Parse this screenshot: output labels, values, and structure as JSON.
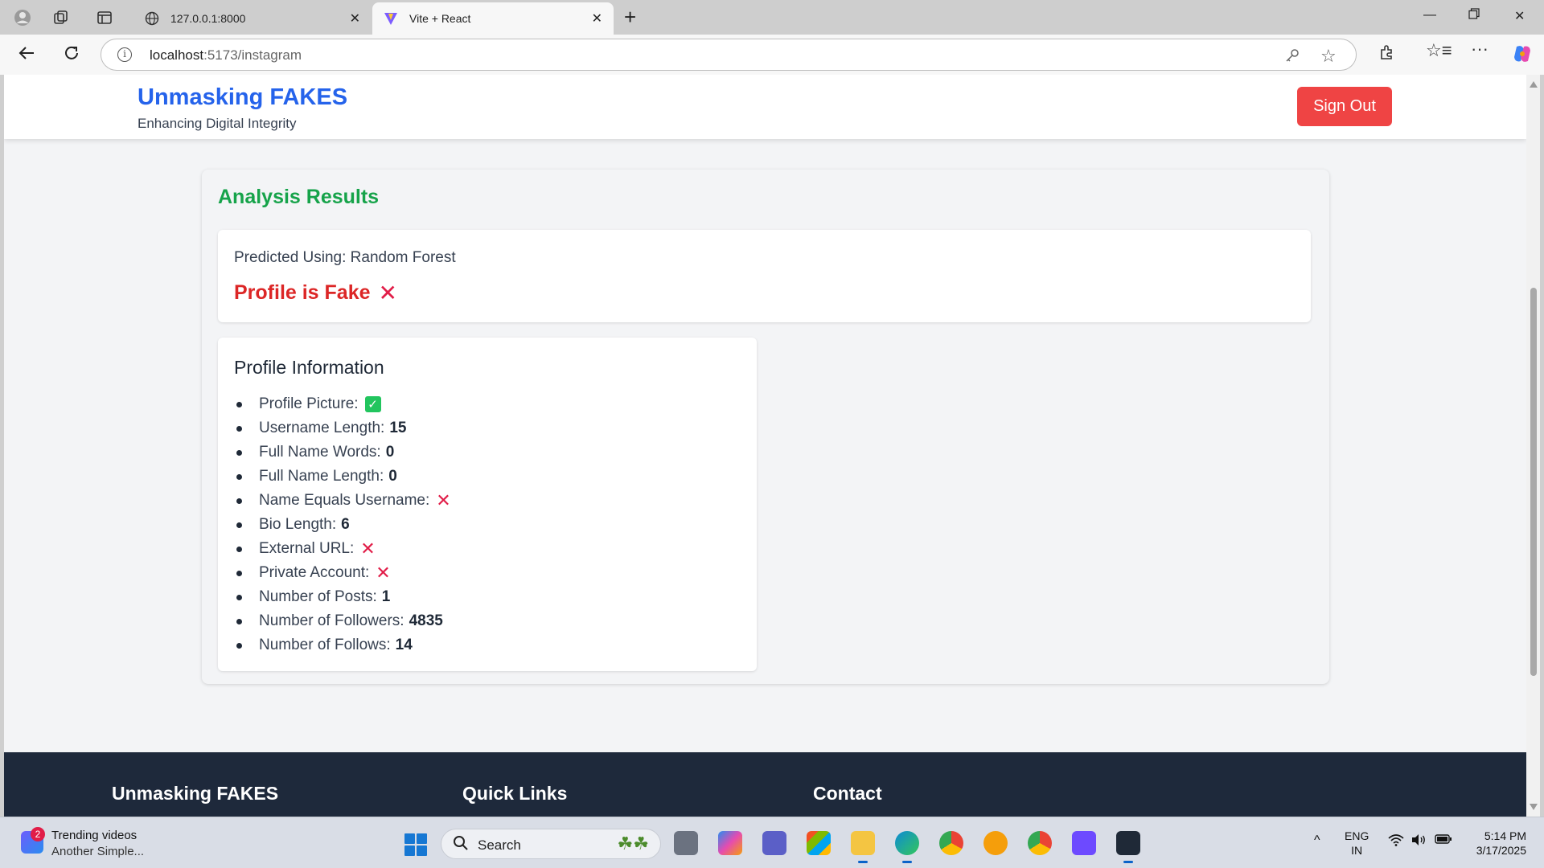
{
  "browser": {
    "tabs": [
      {
        "title": "127.0.0.1:8000",
        "active": false
      },
      {
        "title": "Vite + React",
        "active": true
      }
    ],
    "url_host": "localhost",
    "url_path": ":5173/instagram"
  },
  "header": {
    "brand": "Unmasking FAKES",
    "tagline": "Enhancing Digital Integrity",
    "signout_label": "Sign Out"
  },
  "results": {
    "title": "Analysis Results",
    "predicted_using": "Predicted Using: Random Forest",
    "verdict": "Profile is Fake"
  },
  "profile_info": {
    "title": "Profile Information",
    "items": [
      {
        "label": "Profile Picture:",
        "value": "",
        "icon": "check"
      },
      {
        "label": "Username Length:",
        "value": "15",
        "icon": ""
      },
      {
        "label": "Full Name Words:",
        "value": "0",
        "icon": ""
      },
      {
        "label": "Full Name Length:",
        "value": "0",
        "icon": ""
      },
      {
        "label": "Name Equals Username:",
        "value": "",
        "icon": "cross"
      },
      {
        "label": "Bio Length:",
        "value": "6",
        "icon": ""
      },
      {
        "label": "External URL:",
        "value": "",
        "icon": "cross"
      },
      {
        "label": "Private Account:",
        "value": "",
        "icon": "cross"
      },
      {
        "label": "Number of Posts:",
        "value": "1",
        "icon": ""
      },
      {
        "label": "Number of Followers:",
        "value": "4835",
        "icon": ""
      },
      {
        "label": "Number of Follows:",
        "value": "14",
        "icon": ""
      }
    ]
  },
  "footer": {
    "col1": "Unmasking FAKES",
    "col2": "Quick Links",
    "col3": "Contact"
  },
  "taskbar": {
    "widget_badge": "2",
    "widget_title": "Trending videos",
    "widget_sub": "Another Simple...",
    "search_label": "Search",
    "lang_top": "ENG",
    "lang_bottom": "IN",
    "time": "5:14 PM",
    "date": "3/17/2025"
  },
  "colors": {
    "brand": "#2563eb",
    "success": "#16a34a",
    "danger": "#dc2626",
    "signout": "#ef4444",
    "footer_bg": "#1e293b"
  }
}
